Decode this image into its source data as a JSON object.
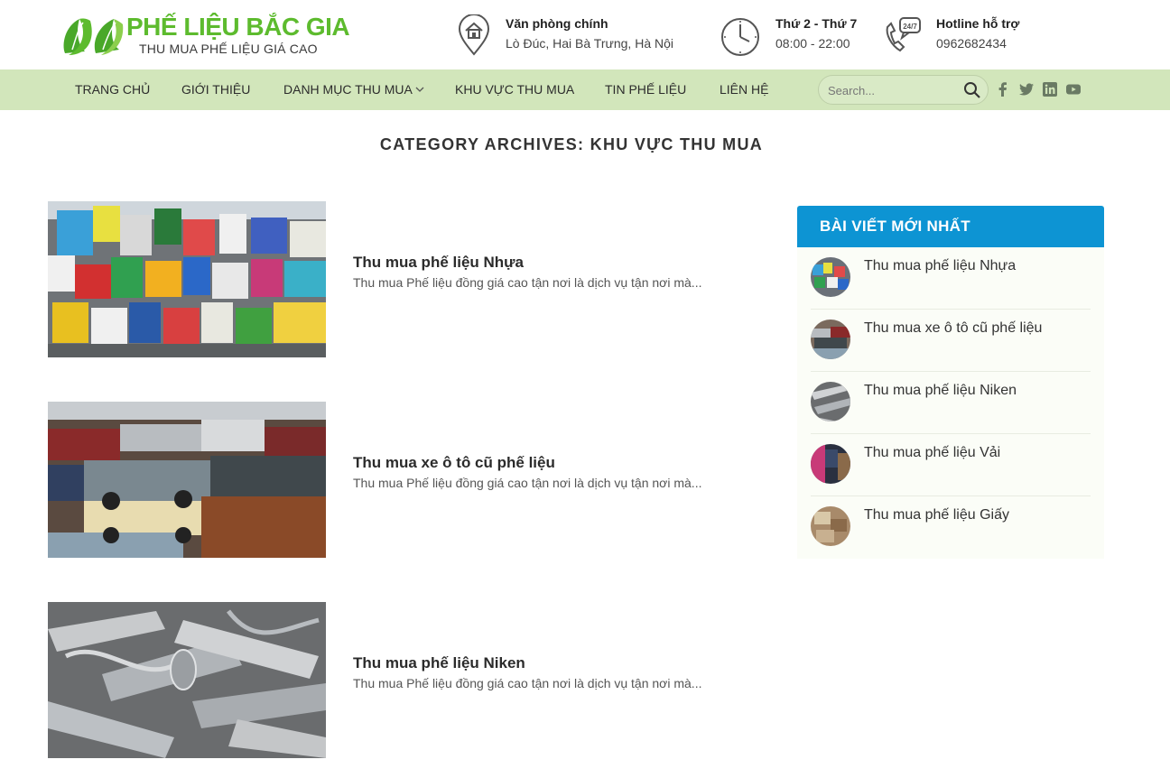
{
  "logo": {
    "name": "PHẾ LIỆU BẮC GIA",
    "tagline": "THU MUA PHẾ LIỆU GIÁ CAO"
  },
  "header_info": {
    "office": {
      "title": "Văn phòng chính",
      "value": "Lò Đúc, Hai Bà Trưng, Hà Nội",
      "icon": "home-location-icon"
    },
    "hours": {
      "title": "Thứ 2 - Thứ 7",
      "value": "08:00 - 22:00",
      "icon": "clock-icon"
    },
    "hotline": {
      "title": "Hotline hỗ trợ",
      "value": "0962682434",
      "icon": "phone-24-7-icon"
    }
  },
  "nav": {
    "items": [
      {
        "label": "TRANG CHỦ"
      },
      {
        "label": "GIỚI THIỆU"
      },
      {
        "label": "DANH MỤC THU MUA"
      },
      {
        "label": "KHU VỰC THU MUA"
      },
      {
        "label": "TIN PHẾ LIỆU"
      },
      {
        "label": "LIÊN HỆ"
      }
    ],
    "search_placeholder": "Search...",
    "social": [
      "facebook-icon",
      "twitter-icon",
      "linkedin-icon",
      "youtube-icon"
    ]
  },
  "page": {
    "title": "CATEGORY ARCHIVES: KHU VỰC THU MUA"
  },
  "posts": [
    {
      "title": "Thu mua phế liệu Nhựa",
      "excerpt": "Thu mua Phế liệu đồng giá cao tận nơi là dịch vụ tận nơi mà..."
    },
    {
      "title": "Thu mua xe ô tô cũ phế liệu",
      "excerpt": "Thu mua Phế liệu đồng giá cao tận nơi là dịch vụ tận nơi mà..."
    },
    {
      "title": "Thu mua phế liệu Niken",
      "excerpt": "Thu mua Phế liệu đồng giá cao tận nơi là dịch vụ tận nơi mà..."
    }
  ],
  "sidebar": {
    "heading": "BÀI VIẾT MỚI NHẤT",
    "items": [
      {
        "title": "Thu mua phế liệu Nhựa"
      },
      {
        "title": "Thu mua xe ô tô cũ phế liệu"
      },
      {
        "title": "Thu mua phế liệu Niken"
      },
      {
        "title": "Thu mua phế liệu Vải"
      },
      {
        "title": "Thu mua phế liệu Giấy"
      }
    ]
  },
  "colors": {
    "brand_green": "#5dbb2e",
    "nav_bg": "#d2e6bb",
    "sidebar_header": "#0d94d3"
  }
}
